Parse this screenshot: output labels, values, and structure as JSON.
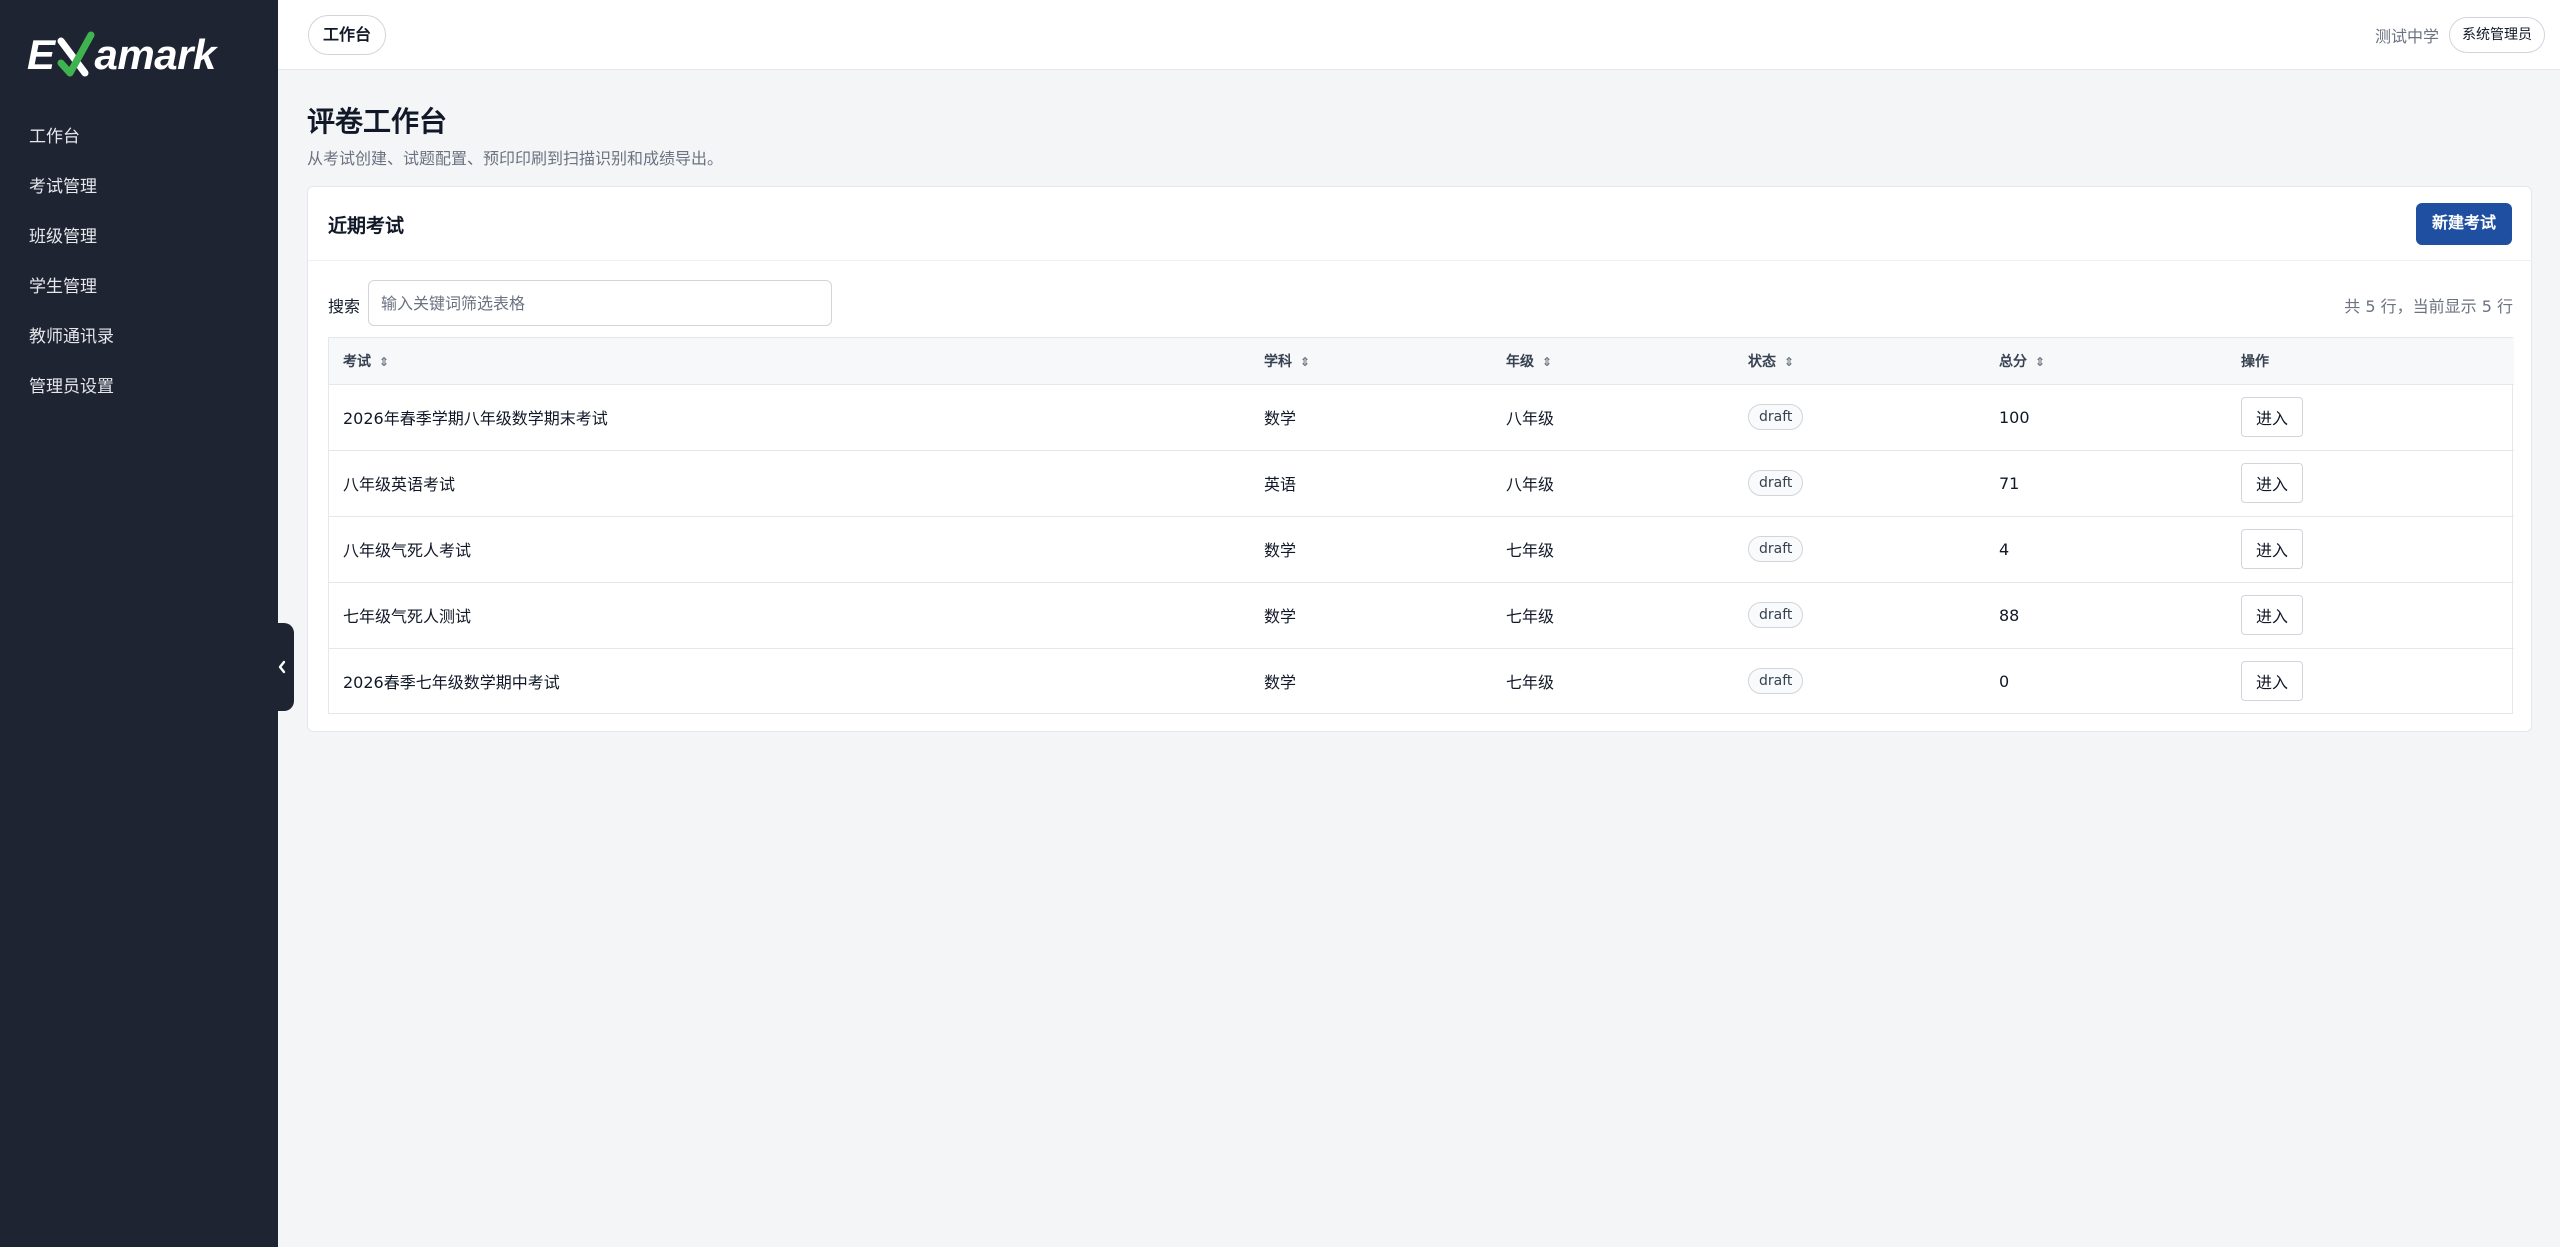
{
  "app": {
    "logo_text": "Examark",
    "logo_prefix": "E",
    "logo_suffix": "amark"
  },
  "sidebar": {
    "items": [
      {
        "label": "工作台"
      },
      {
        "label": "考试管理"
      },
      {
        "label": "班级管理"
      },
      {
        "label": "学生管理"
      },
      {
        "label": "教师通讯录"
      },
      {
        "label": "管理员设置"
      }
    ],
    "collapse_icon": "chevron-left-icon"
  },
  "topbar": {
    "active_tab": "工作台",
    "school": "测试中学",
    "role": "系统管理员"
  },
  "page": {
    "title": "评卷工作台",
    "subtitle": "从考试创建、试题配置、预印印刷到扫描识别和成绩导出。"
  },
  "card": {
    "title": "近期考试",
    "new_button": "新建考试",
    "search_label": "搜索",
    "search_placeholder": "输入关键词筛选表格",
    "search_value": "",
    "row_count": "共 5 行，当前显示 5 行"
  },
  "table": {
    "columns": [
      "考试",
      "学科",
      "年级",
      "状态",
      "总分",
      "操作"
    ],
    "rows": [
      {
        "exam": "2026年春季学期八年级数学期末考试",
        "subject": "数学",
        "grade": "八年级",
        "status": "draft",
        "total": "100",
        "action": "进入"
      },
      {
        "exam": "八年级英语考试",
        "subject": "英语",
        "grade": "八年级",
        "status": "draft",
        "total": "71",
        "action": "进入"
      },
      {
        "exam": "八年级气死人考试",
        "subject": "数学",
        "grade": "七年级",
        "status": "draft",
        "total": "4",
        "action": "进入"
      },
      {
        "exam": "七年级气死人测试",
        "subject": "数学",
        "grade": "七年级",
        "status": "draft",
        "total": "88",
        "action": "进入"
      },
      {
        "exam": "2026春季七年级数学期中考试",
        "subject": "数学",
        "grade": "七年级",
        "status": "draft",
        "total": "0",
        "action": "进入"
      }
    ]
  },
  "colors": {
    "sidebar_bg": "#1f2433",
    "primary": "#1f4fa0",
    "logo_check": "#3fb34f"
  }
}
